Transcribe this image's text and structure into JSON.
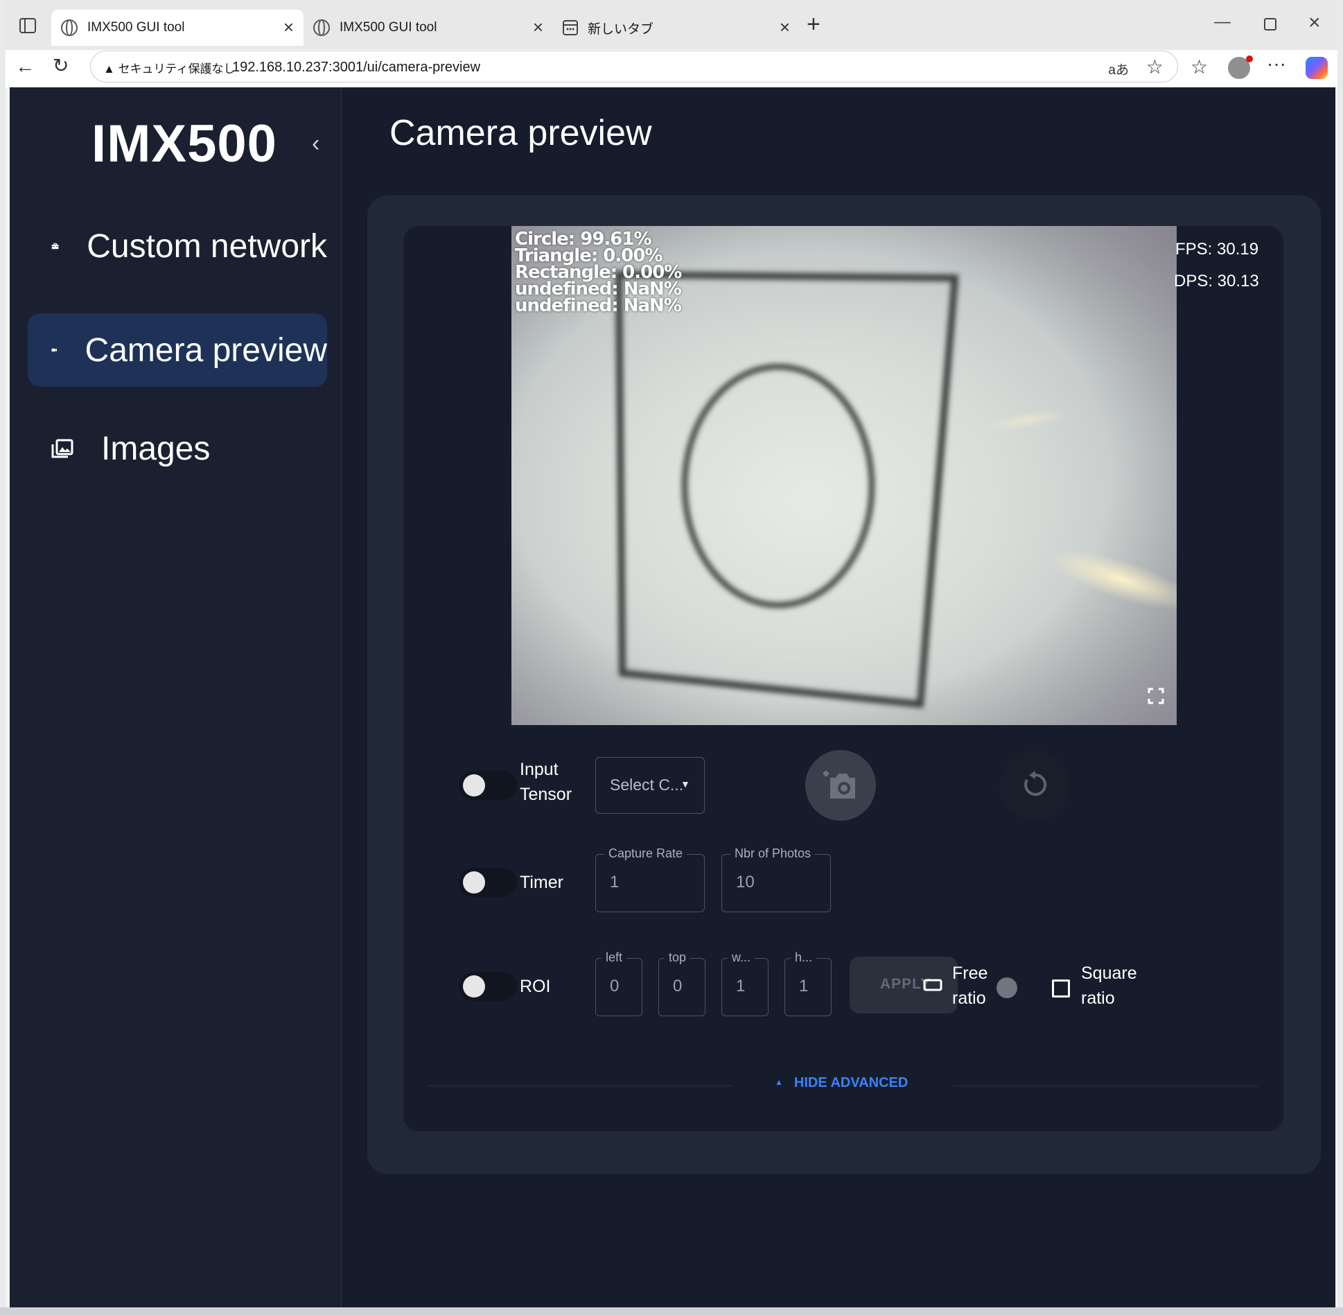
{
  "browser": {
    "tabs": [
      {
        "title": "IMX500 GUI tool",
        "active": true
      },
      {
        "title": "IMX500 GUI tool",
        "active": false
      },
      {
        "title": "新しいタブ",
        "active": false
      }
    ],
    "security_label": "セキュリティ保護なし",
    "url": "192.168.10.237:3001/ui/camera-preview",
    "read_aloud": "aあ"
  },
  "sidebar": {
    "logo": "IMX500",
    "items": [
      {
        "label": "Custom network",
        "icon": "briefcase-icon",
        "active": false
      },
      {
        "label": "Camera preview",
        "icon": "videocam-icon",
        "active": true
      },
      {
        "label": "Images",
        "icon": "photo-library-icon",
        "active": false
      }
    ]
  },
  "main": {
    "title": "Camera preview",
    "detections": [
      "Circle: 99.61%",
      "Triangle: 0.00%",
      "Rectangle: 0.00%",
      "undefined: NaN%",
      "undefined: NaN%"
    ],
    "fps": "FPS: 30.19",
    "dps": "DPS: 30.13",
    "controls": {
      "input_tensor": {
        "label_line1": "Input",
        "label_line2": "Tensor",
        "on": false
      },
      "select_placeholder": "Select C...",
      "timer": {
        "label": "Timer",
        "on": false
      },
      "capture_rate": {
        "legend": "Capture Rate",
        "value": "1"
      },
      "nbr_photos": {
        "legend": "Nbr of Photos",
        "value": "10"
      },
      "roi": {
        "label": "ROI",
        "on": false
      },
      "roi_left": {
        "legend": "left",
        "value": "0"
      },
      "roi_top": {
        "legend": "top",
        "value": "0"
      },
      "roi_w": {
        "legend": "w...",
        "value": "1"
      },
      "roi_h": {
        "legend": "h...",
        "value": "1"
      },
      "apply_label": "APPLY",
      "free_ratio": {
        "line1": "Free",
        "line2": "ratio",
        "selected": true
      },
      "square_ratio": {
        "line1": "Square",
        "line2": "ratio",
        "checked": false
      },
      "hide_advanced": "HIDE ADVANCED"
    }
  },
  "colors": {
    "accent": "#3b82f6",
    "active_nav": "#1e3258",
    "background": "#161c2b"
  }
}
